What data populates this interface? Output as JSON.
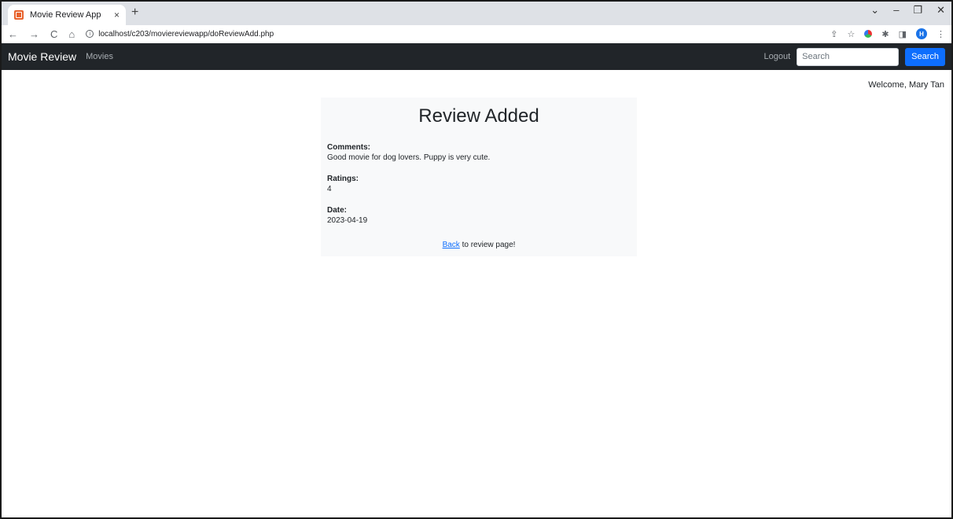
{
  "browser": {
    "tab_title": "Movie Review App",
    "tab_close": "×",
    "new_tab": "+",
    "url": "localhost/c203/moviereviewapp/doReviewAdd.php",
    "profile_initial": "H"
  },
  "navbar": {
    "brand": "Movie Review",
    "movies_link": "Movies",
    "logout_link": "Logout",
    "search_placeholder": "Search",
    "search_button": "Search"
  },
  "welcome": "Welcome, Mary Tan",
  "review": {
    "title": "Review Added",
    "comments_label": "Comments:",
    "comments_value": "Good movie for dog lovers. Puppy is very cute.",
    "ratings_label": "Ratings:",
    "ratings_value": "4",
    "date_label": "Date:",
    "date_value": "2023-04-19",
    "back_link": "Back",
    "back_suffix": " to review page!"
  },
  "colors": {
    "navbar_bg": "#212529",
    "search_button_bg": "#0d6efd",
    "card_bg": "#f8f9fa",
    "link": "#0d6efd"
  }
}
